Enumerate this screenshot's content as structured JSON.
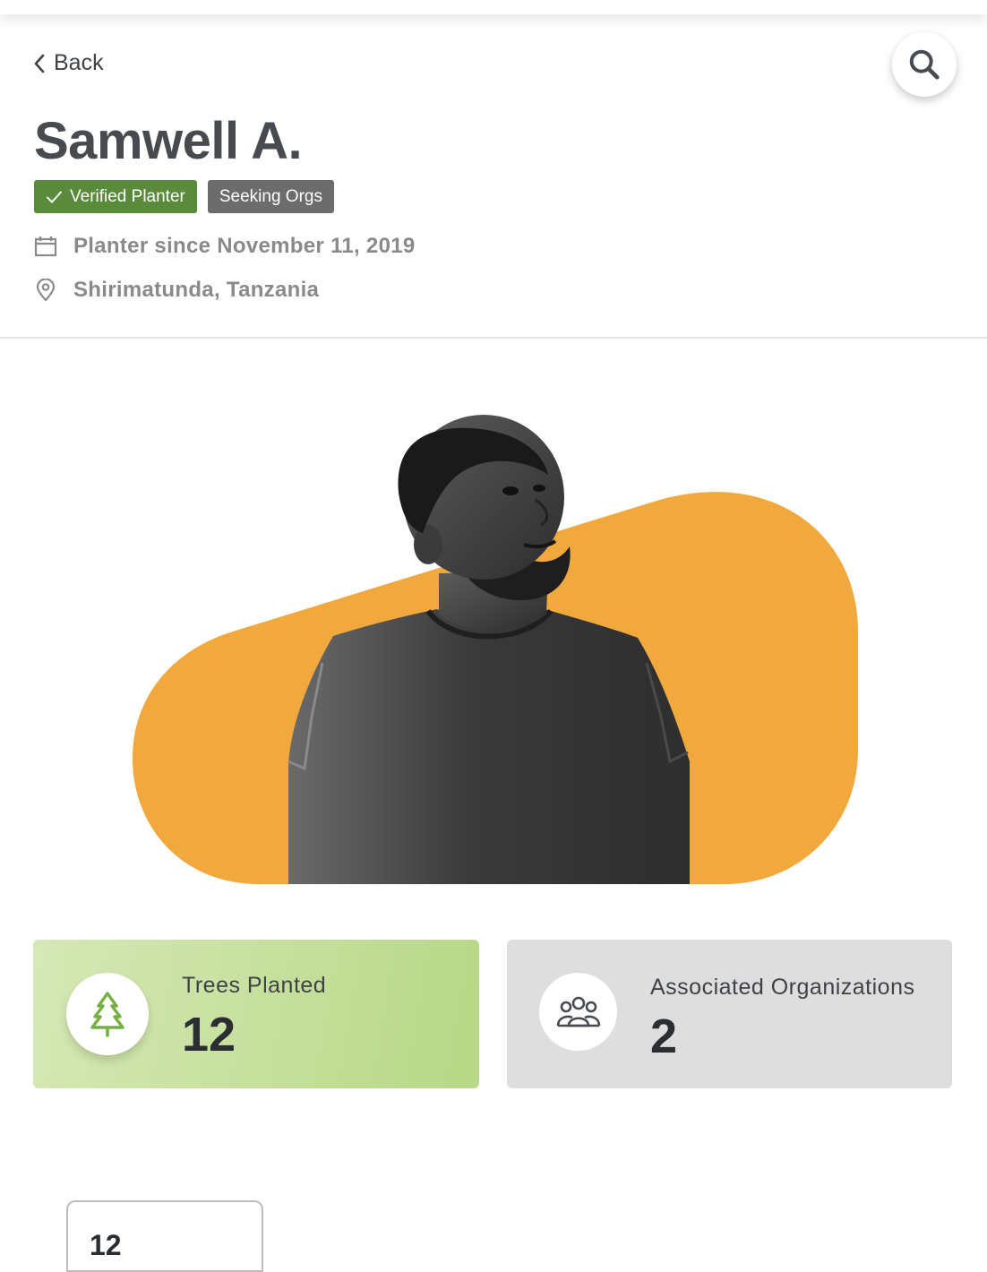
{
  "nav": {
    "back_label": "Back"
  },
  "profile": {
    "name": "Samwell A.",
    "badges": {
      "verified": "Verified Planter",
      "seeking": "Seeking Orgs"
    },
    "since": "Planter since November 11, 2019",
    "location": "Shirimatunda, Tanzania"
  },
  "stats": {
    "trees": {
      "label": "Trees Planted",
      "value": "12"
    },
    "orgs": {
      "label": "Associated Organizations",
      "value": "2"
    }
  },
  "tree_card": {
    "value": "12"
  },
  "colors": {
    "accent_orange": "#f1a83c",
    "verified_green": "#5a8a3c",
    "seeking_gray": "#6c6c6c",
    "trees_card_green": "#c3dd98",
    "orgs_card_gray": "#dedede",
    "tree_icon_green": "#76b041"
  }
}
